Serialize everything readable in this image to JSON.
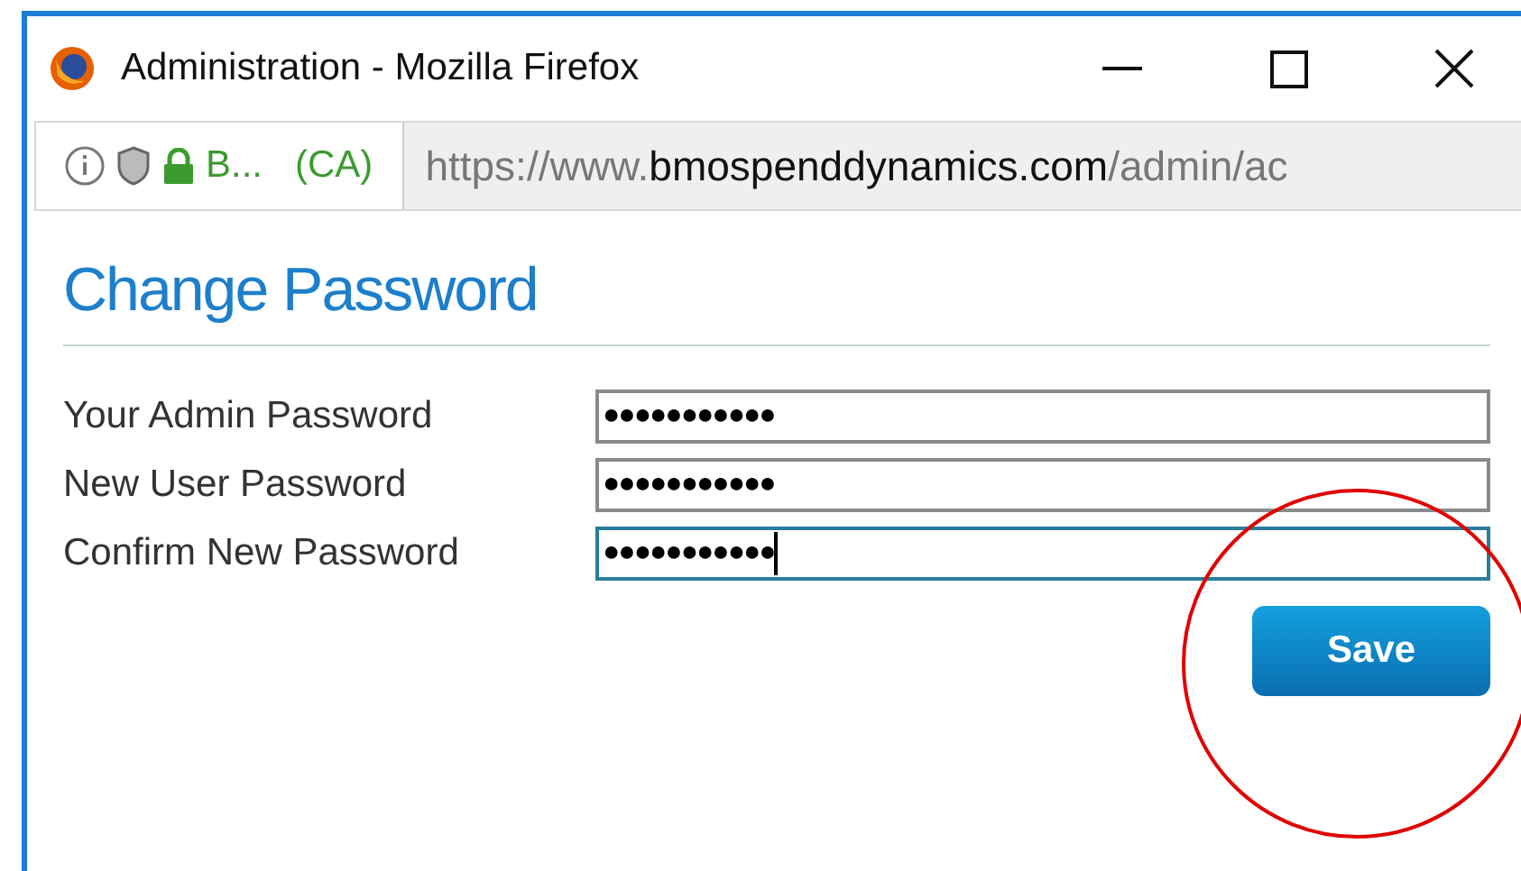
{
  "window": {
    "title": "Administration - Mozilla Firefox"
  },
  "address_bar": {
    "site_identity": "B...",
    "country": "(CA)",
    "url_scheme": "https://www.",
    "url_domain": "bmospenddynamics.com",
    "url_path": "/admin/ac"
  },
  "page": {
    "heading": "Change Password",
    "fields": [
      {
        "label": "Your Admin Password",
        "value": "●●●●●●●●●●●",
        "focused": false
      },
      {
        "label": "New User Password",
        "value": "●●●●●●●●●●●",
        "focused": false
      },
      {
        "label": "Confirm New Password",
        "value": "●●●●●●●●●●●",
        "focused": true
      }
    ],
    "save_button": "Save"
  }
}
